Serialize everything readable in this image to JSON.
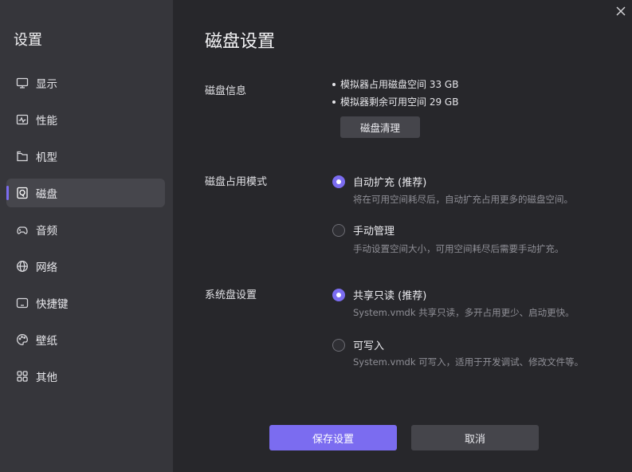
{
  "sidebar": {
    "title": "设置",
    "items": [
      {
        "label": "显示",
        "icon": "monitor-icon",
        "active": false
      },
      {
        "label": "性能",
        "icon": "performance-icon",
        "active": false
      },
      {
        "label": "机型",
        "icon": "device-model-icon",
        "active": false
      },
      {
        "label": "磁盘",
        "icon": "disk-icon",
        "active": true
      },
      {
        "label": "音频",
        "icon": "audio-icon",
        "active": false
      },
      {
        "label": "网络",
        "icon": "network-globe-icon",
        "active": false
      },
      {
        "label": "快捷键",
        "icon": "keyboard-icon",
        "active": false
      },
      {
        "label": "壁纸",
        "icon": "palette-icon",
        "active": false
      },
      {
        "label": "其他",
        "icon": "grid-icon",
        "active": false
      }
    ]
  },
  "main": {
    "title": "磁盘设置",
    "disk_info": {
      "label": "磁盘信息",
      "lines": [
        "模拟器占用磁盘空间 33 GB",
        "模拟器剩余可用空间 29 GB"
      ],
      "clean_button": "磁盘清理"
    },
    "disk_mode": {
      "label": "磁盘占用模式",
      "options": [
        {
          "label": "自动扩充 (推荐)",
          "desc": "将在可用空间耗尽后，自动扩充占用更多的磁盘空间。",
          "checked": true
        },
        {
          "label": "手动管理",
          "desc": "手动设置空间大小，可用空间耗尽后需要手动扩充。",
          "checked": false
        }
      ]
    },
    "system_disk": {
      "label": "系统盘设置",
      "options": [
        {
          "label": "共享只读 (推荐)",
          "desc": "System.vmdk 共享只读，多开占用更少、启动更快。",
          "checked": true
        },
        {
          "label": "可写入",
          "desc": "System.vmdk 可写入，适用于开发调试、修改文件等。",
          "checked": false
        }
      ]
    },
    "save_button": "保存设置",
    "cancel_button": "取消"
  },
  "colors": {
    "accent": "#7b6cf0",
    "sidebar_bg": "#36363b",
    "main_bg": "#27272b"
  }
}
